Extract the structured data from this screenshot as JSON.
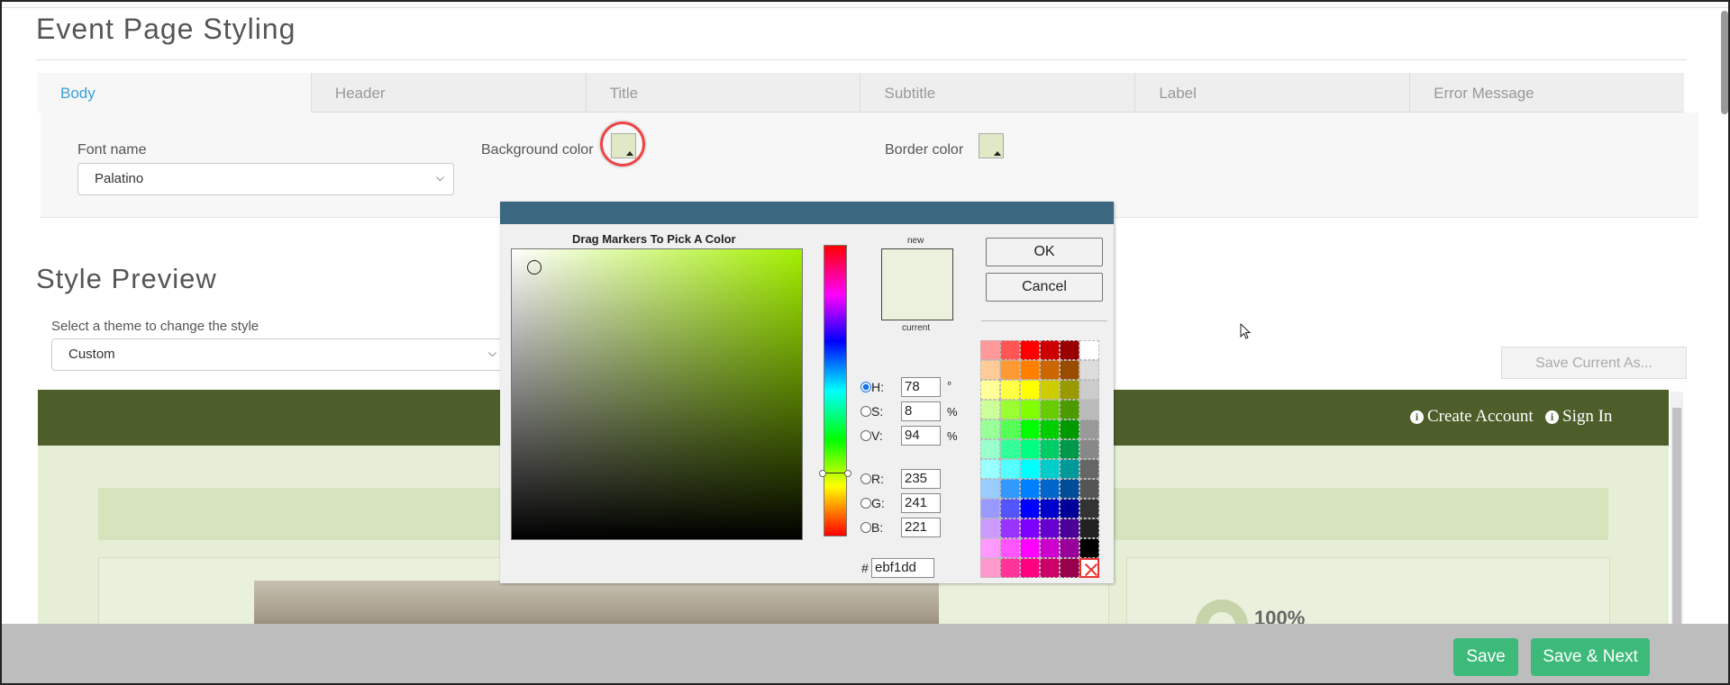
{
  "page": {
    "title": "Event Page Styling",
    "preview_title": "Style Preview"
  },
  "tabs": [
    "Body",
    "Header",
    "Title",
    "Subtitle",
    "Label",
    "Error Message"
  ],
  "body_panel": {
    "font_label": "Font name",
    "font_value": "Palatino",
    "bg_label": "Background color",
    "border_label": "Border color"
  },
  "theme": {
    "label": "Select a theme to change the style",
    "value": "Custom"
  },
  "save_current_as": "Save Current As...",
  "preview": {
    "create_account": "Create Account",
    "sign_in": "Sign In",
    "percent": "100%"
  },
  "footer": {
    "save": "Save",
    "save_next": "Save & Next"
  },
  "color_picker": {
    "instruction": "Drag Markers To Pick A Color",
    "new_label": "new",
    "current_label": "current",
    "ok": "OK",
    "cancel": "Cancel",
    "h_label": "H:",
    "h": "78",
    "h_unit": "°",
    "s_label": "S:",
    "s": "8",
    "s_unit": "%",
    "v_label": "V:",
    "v": "94",
    "v_unit": "%",
    "r_label": "R:",
    "r": "235",
    "g_label": "G:",
    "g": "241",
    "b_label": "B:",
    "b": "221",
    "hash": "#",
    "hex": "ebf1dd",
    "selected_color": "#ebf1dd"
  },
  "palette": [
    "#ff9999",
    "#ff5555",
    "#ff0000",
    "#cc0000",
    "#990000",
    "#ffffff",
    "#ffcc99",
    "#ff9933",
    "#ff8000",
    "#cc6600",
    "#994c00",
    "#dddddd",
    "#ffff99",
    "#ffff44",
    "#ffff00",
    "#cccc00",
    "#999900",
    "#cccccc",
    "#ccff99",
    "#99ff33",
    "#80ff00",
    "#66cc00",
    "#4c9900",
    "#bbbbbb",
    "#99ff99",
    "#55ff55",
    "#00ff00",
    "#00cc00",
    "#009900",
    "#999999",
    "#99ffcc",
    "#33ff99",
    "#00ff80",
    "#00cc66",
    "#00994c",
    "#888888",
    "#99ffff",
    "#55ffff",
    "#00ffff",
    "#00cccc",
    "#009999",
    "#666666",
    "#99ccff",
    "#3399ff",
    "#0080ff",
    "#0066cc",
    "#004c99",
    "#555555",
    "#9999ff",
    "#5555ff",
    "#0000ff",
    "#0000cc",
    "#000099",
    "#333333",
    "#cc99ff",
    "#9933ff",
    "#8000ff",
    "#6600cc",
    "#4c0099",
    "#222222",
    "#ff99ff",
    "#ff55ff",
    "#ff00ff",
    "#cc00cc",
    "#990099",
    "#000000",
    "#ff99cc",
    "#ff3399",
    "#ff0080",
    "#cc0066",
    "#99004c",
    "none"
  ]
}
